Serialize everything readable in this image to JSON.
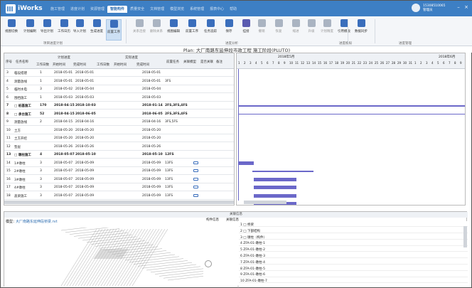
{
  "app": {
    "brand": "iWorks"
  },
  "menu": [
    "施工管理",
    "进度计划",
    "资源管理",
    "智能构件",
    "质量安全",
    "文档管理",
    "模型浏览",
    "系统管理",
    "报表中心",
    "帮助"
  ],
  "user": {
    "id": "15308510065",
    "name": "管理员"
  },
  "toolbar": {
    "tools": [
      "视图切换",
      "计划编制",
      "导出计划",
      "工作日历",
      "导入计划",
      "生成进度",
      "前置工序",
      "关系连接",
      "删除关系",
      "视图编辑",
      "前置工序",
      "任务追踪",
      "保存",
      "挂接",
      "撤销",
      "恢复",
      "缩进",
      "升级",
      "计划精度",
      "清空进度",
      "引用模板",
      "数据同步",
      "实际完成",
      "实际开始",
      "计划调整"
    ],
    "groups": [
      "项目进度计划",
      "进度分析",
      "进度模拟",
      "进度管理"
    ]
  },
  "gantt_title": "Plan:  大厂南路东延伸段市政工程  施工阶段(PLUTO)",
  "grid": {
    "headers": {
      "main": [
        "序号",
        "任务名称",
        "工作日数",
        "开始时间",
        "完成时间",
        "工作日数",
        "开始时间",
        "完成时间",
        "前置任务",
        "关联模型",
        "是否关联",
        "备注"
      ],
      "groups": [
        "计划进度",
        "实际进度"
      ]
    },
    "rows": [
      [
        "3",
        "临设搭建",
        "1",
        "2018-05-01",
        "2018-05-01",
        "",
        "",
        "2018-05-01",
        "",
        ""
      ],
      [
        "4",
        "测量放线",
        "1",
        "2018-05-01",
        "2018-05-01",
        "",
        "",
        "2018-05-01",
        "3FS",
        ""
      ],
      [
        "5",
        "临时水电",
        "3",
        "2018-05-02",
        "2018-05-04",
        "",
        "",
        "2018-05-04",
        "",
        ""
      ],
      [
        "6",
        "围挡施工",
        "1",
        "2018-05-03",
        "2018-05-03",
        "",
        "",
        "2018-05-03",
        "",
        ""
      ],
      [
        "7",
        "□ 桩基施工",
        "170",
        "2018-04-15",
        "2018-10-03",
        "",
        "",
        "2018-01-14",
        "2FS,3FS,4FS",
        ""
      ],
      [
        "8",
        "□ 承台施工",
        "52",
        "2018-04-15",
        "2018-06-05",
        "",
        "",
        "2018-06-05",
        "2FS,3FS,4FS",
        ""
      ],
      [
        "9",
        "测量放线",
        "2",
        "2018-04-15",
        "2018-04-16",
        "",
        "",
        "2018-04-16",
        "3FS,5FS",
        ""
      ],
      [
        "10",
        "土方",
        "",
        "2018-05-20",
        "2018-05-20",
        "",
        "",
        "2018-05-20",
        "",
        ""
      ],
      [
        "11",
        "土方开挖",
        "",
        "2018-05-20",
        "2018-05-20",
        "",
        "",
        "2018-05-20",
        "",
        ""
      ],
      [
        "12",
        "垫层",
        "",
        "2018-05-26",
        "2018-05-26",
        "",
        "",
        "2018-05-26",
        "",
        ""
      ],
      [
        "13",
        "□ 墩柱施工",
        "4",
        "2018-05-07",
        "2018-05-10",
        "",
        "",
        "2018-05-10",
        "12FS",
        ""
      ],
      [
        "14",
        "1#墩柱",
        "3",
        "2018-05-07",
        "2018-05-09",
        "",
        "",
        "2018-05-09",
        "13FS",
        "已关联"
      ],
      [
        "15",
        "2#墩柱",
        "3",
        "2018-05-07",
        "2018-05-09",
        "",
        "",
        "2018-05-09",
        "13FS",
        ""
      ],
      [
        "16",
        "3#墩柱",
        "3",
        "2018-05-07",
        "2018-05-09",
        "",
        "",
        "2018-05-09",
        "13FS",
        ""
      ],
      [
        "17",
        "4#墩柱",
        "3",
        "2018-05-07",
        "2018-05-09",
        "",
        "",
        "2018-05-09",
        "13FS",
        ""
      ],
      [
        "18",
        "盖梁施工",
        "3",
        "2018-05-07",
        "2018-05-09",
        "",
        "",
        "2018-05-09",
        "13FS",
        ""
      ]
    ]
  },
  "timeline": {
    "months": [
      "2018年5月",
      "2018年6月"
    ]
  },
  "bottom": {
    "header": "关联信息",
    "model_label": "模型：",
    "model_name": "大厂南路东延伸段桥梁.rvt",
    "tree_header": [
      "构件信息",
      "关联信息"
    ],
    "tree": [
      "1  □ 桥梁",
      "2    □ 下部结构",
      "3      □ 墩柱（构件）",
      "4          ZFA-01-墩柱-1",
      "5          ZFA-01-墩柱-2",
      "6          ZFA-01-墩柱-3",
      "7          ZFA-01-墩柱-4",
      "8          ZFA-01-墩柱-5",
      "9          ZFA-01-墩柱-6",
      "10         ZFA-01-墩柱-7"
    ]
  }
}
